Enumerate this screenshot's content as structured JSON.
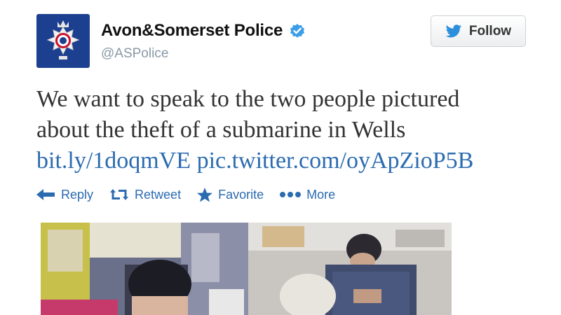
{
  "account": {
    "display_name": "Avon&Somerset Police",
    "handle": "@ASPolice",
    "avatar_icon": "police-badge-icon",
    "verified_icon": "verified-badge-icon"
  },
  "follow_button": {
    "label": "Follow",
    "icon": "twitter-bird-icon"
  },
  "tweet": {
    "line1": "We want to speak to the two people pictured",
    "line2": "about the theft of a submarine in Wells",
    "link1": "bit.ly/1doqmVE",
    "link2": "pic.twitter.com/oyApZioP5B"
  },
  "actions": {
    "reply": "Reply",
    "retweet": "Retweet",
    "favorite": "Favorite",
    "more": "More"
  },
  "media": [
    {
      "icon": "cctv-photo-1"
    },
    {
      "icon": "cctv-photo-2"
    }
  ],
  "colors": {
    "link": "#2b6bb0",
    "avatar_bg": "#1d3f8f",
    "verified": "#3d9ee8",
    "handle": "#8899a6"
  }
}
